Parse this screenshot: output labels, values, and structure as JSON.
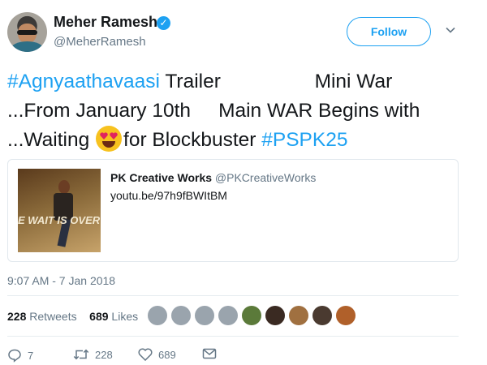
{
  "author": {
    "name": "Meher Ramesh",
    "handle": "@MeherRamesh",
    "verified": true
  },
  "follow_button": {
    "label": "Follow"
  },
  "tweet": {
    "lines": [
      {
        "hashtag": "#Agnyaathavaasi",
        "text": " Trailer                 Mini War"
      },
      {
        "text": "...From January 10th     Main WAR Begins with"
      },
      {
        "pre": "...Waiting ",
        "emoji": "heart-eyes-emoji",
        "post": "for Blockbuster ",
        "hashtag": "#PSPK25"
      }
    ]
  },
  "card": {
    "title": "PK Creative Works",
    "handle": "@PKCreativeWorks",
    "url": "youtu.be/97h9fBWItBM",
    "image_text": "E WAIT IS OVER"
  },
  "timestamp": "9:07 AM - 7 Jan 2018",
  "stats": {
    "retweets_count": "228",
    "retweets_label": "Retweets",
    "likes_count": "689",
    "likes_label": "Likes"
  },
  "likers": [
    "#9aa4ad",
    "#9aa4ad",
    "#9aa4ad",
    "#9aa4ad",
    "#5b7a3a",
    "#3a2a22",
    "#a07040",
    "#4a3a30",
    "#b0602a"
  ],
  "actions": {
    "reply_count": "7",
    "retweet_count": "228",
    "like_count": "689"
  },
  "colors": {
    "accent": "#1da1f2",
    "muted": "#657786",
    "text": "#14171a"
  }
}
